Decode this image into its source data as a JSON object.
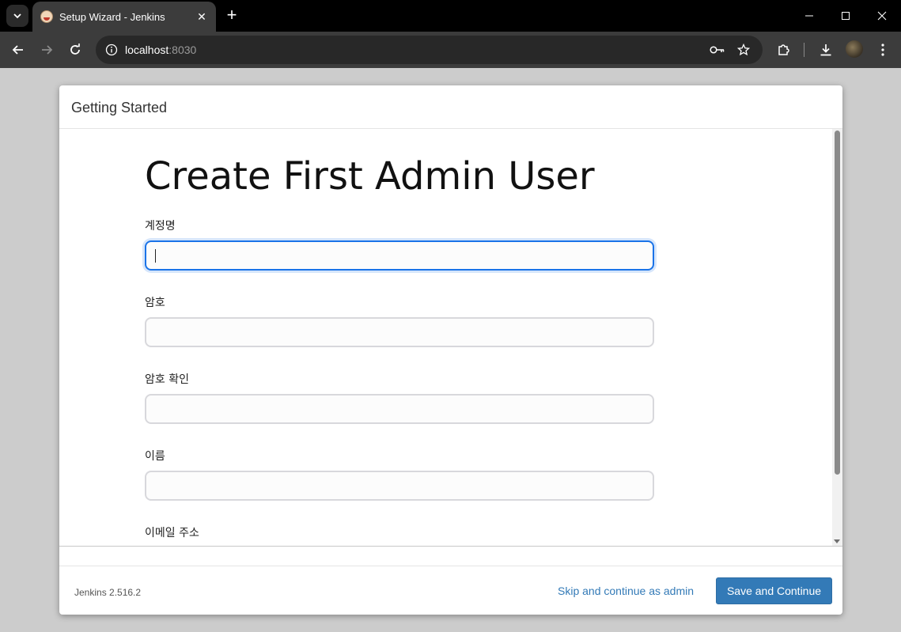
{
  "browser": {
    "tab_title": "Setup Wizard - Jenkins",
    "url_host": "localhost",
    "url_port": ":8030"
  },
  "dialog": {
    "header_title": "Getting Started",
    "form_title": "Create First Admin User",
    "fields": [
      {
        "label": "계정명",
        "value": ""
      },
      {
        "label": "암호",
        "value": ""
      },
      {
        "label": "암호 확인",
        "value": ""
      },
      {
        "label": "이름",
        "value": ""
      },
      {
        "label": "이메일 주소",
        "value": ""
      }
    ],
    "footer": {
      "version": "Jenkins 2.516.2",
      "skip_label": "Skip and continue as admin",
      "save_label": "Save and Continue"
    }
  },
  "colors": {
    "primary_button": "#337ab7",
    "focus_ring": "#1a73e8"
  },
  "icons": {
    "tab_search": "chevron-down-icon",
    "back": "arrow-left-icon",
    "forward": "arrow-right-icon",
    "reload": "reload-icon",
    "site_info": "info-icon",
    "password_key": "key-icon",
    "bookmark": "star-icon",
    "extensions": "puzzle-icon",
    "downloads": "download-icon",
    "menu": "kebab-menu-icon"
  }
}
